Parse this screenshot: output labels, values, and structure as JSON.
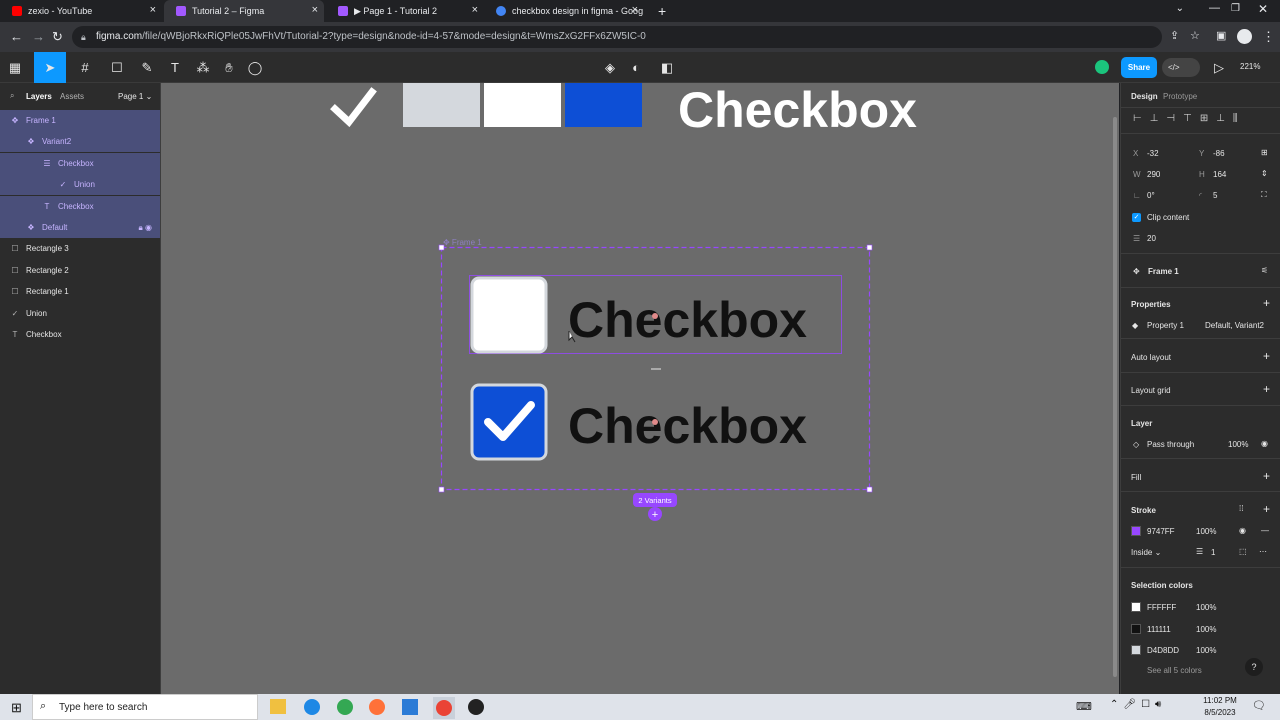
{
  "browser": {
    "tabs": [
      {
        "title": "zexio - YouTube",
        "color": "#ff0000"
      },
      {
        "title": "Tutorial 2 – Figma",
        "color": "#a259ff"
      },
      {
        "title": "▶ Page 1 - Tutorial 2",
        "color": "#a259ff"
      },
      {
        "title": "checkbox design in figma - Goog",
        "color": "#4285f4"
      }
    ],
    "new_tab": "+",
    "url_domain": "figma.com",
    "url_rest": "/file/qWBjoRkxRiQPle05JwFhVt/Tutorial-2?type=design&node-id=4-57&mode=design&t=WmsZxG2FFx6ZW5IC-0"
  },
  "toolbar": {
    "share": "Share",
    "zoom": "221%",
    "code_icon": "</>"
  },
  "left_panel": {
    "tab_layers": "Layers",
    "tab_assets": "Assets",
    "page": "Page 1 ⌄",
    "layers": [
      {
        "name": "Frame 1",
        "icon": "✥",
        "indent": 0,
        "sel": true
      },
      {
        "name": "Variant2",
        "icon": "❖",
        "indent": 16,
        "sel": true
      },
      {
        "name": "Checkbox",
        "icon": "☰",
        "indent": 32,
        "sel": true
      },
      {
        "name": "Union",
        "icon": "✓",
        "indent": 48,
        "sel": true
      },
      {
        "name": "Checkbox",
        "icon": "T",
        "indent": 32,
        "sel": true
      },
      {
        "name": "Default",
        "icon": "❖",
        "indent": 16,
        "sel": true
      },
      {
        "name": "Rectangle 3",
        "icon": "☐",
        "indent": 0,
        "sel": false
      },
      {
        "name": "Rectangle 2",
        "icon": "☐",
        "indent": 0,
        "sel": false
      },
      {
        "name": "Rectangle 1",
        "icon": "☐",
        "indent": 0,
        "sel": false
      },
      {
        "name": "Union",
        "icon": "✓",
        "indent": 0,
        "sel": false
      },
      {
        "name": "Checkbox",
        "icon": "T",
        "indent": 0,
        "sel": false
      }
    ]
  },
  "canvas": {
    "header_text": "Checkbox",
    "frame_label": "✥ Frame 1",
    "row_text": "Checkbox",
    "variants_badge": "2 Variants",
    "add_variant": "+",
    "swatch_colors": [
      "#d4d8dd",
      "#ffffff",
      "#0d4fd6"
    ],
    "accent": "#9747ff"
  },
  "right_panel": {
    "tab_design": "Design",
    "tab_prototype": "Prototype",
    "x_label": "X",
    "x": "-32",
    "y_label": "Y",
    "y": "-86",
    "w_label": "W",
    "w": "290",
    "h_label": "H",
    "h": "164",
    "rotation": "0°",
    "radius": "5",
    "clip": "Clip content",
    "spacing": "20",
    "component": "Frame 1",
    "properties": "Properties",
    "prop_name": "Property 1",
    "prop_value": "Default, Variant2",
    "auto_layout": "Auto layout",
    "layout_grid": "Layout grid",
    "layer": "Layer",
    "blend": "Pass through",
    "layer_opacity": "100%",
    "fill": "Fill",
    "stroke": "Stroke",
    "stroke_color": "9747FF",
    "stroke_opacity": "100%",
    "stroke_pos": "Inside ⌄",
    "stroke_weight": "1",
    "selection_colors": "Selection colors",
    "colors": [
      {
        "hex": "FFFFFF",
        "opacity": "100%",
        "swatch": "#ffffff"
      },
      {
        "hex": "111111",
        "opacity": "100%",
        "swatch": "#111111"
      },
      {
        "hex": "D4D8DD",
        "opacity": "100%",
        "swatch": "#d4d8dd"
      }
    ],
    "see_all": "See all 5 colors",
    "help": "?"
  },
  "taskbar": {
    "search": "Type here to search",
    "time": "11:02 PM",
    "date": "8/5/2023"
  }
}
